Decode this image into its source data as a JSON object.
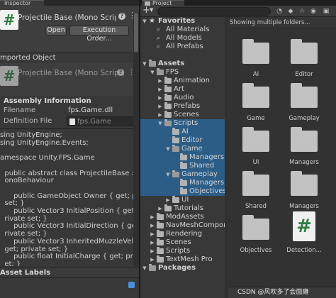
{
  "inspector": {
    "tab_label": "Inspector",
    "header": {
      "title": "Projectile Base (Mono Script)",
      "open_label": "Open",
      "exec_order_label": "Execution Order..."
    },
    "imported_object_label": "mported Object",
    "component": {
      "title": "Projectile Base (Mono Script)"
    },
    "assembly": {
      "title": "Assembly Information",
      "filename_label": "Filename",
      "filename_value": "fps.Game.dll",
      "definition_label": "Definition File",
      "definition_value": "fps.Game"
    },
    "code_lines": [
      "sing UnityEngine;",
      "sing UnityEngine.Events;",
      "",
      "amespace Unity.FPS.Game",
      "",
      "  public abstract class ProjectileBase :",
      "  onoBehaviour",
      "",
      "      public GameObject Owner { get; private",
      "  set; }",
      "      public Vector3 InitialPosition { get;",
      "  rivate set; }",
      "      public Vector3 InitialDirection { get;",
      "  rivate set; }",
      "      public Vector3 InheritedMuzzleVelocity",
      "  get; private set; }",
      "      public float InitialCharge { get; private",
      "  et; }"
    ],
    "asset_labels": "Asset Labels"
  },
  "project": {
    "tab_label": "Project",
    "grid_header": "Showing multiple folders...",
    "tree": [
      {
        "label": "Favorites",
        "depth": 0,
        "expanded": true,
        "kind": "star",
        "bold": true,
        "selected": false
      },
      {
        "label": "All Materials",
        "depth": 1,
        "kind": "search",
        "selected": false
      },
      {
        "label": "All Models",
        "depth": 1,
        "kind": "search",
        "selected": false
      },
      {
        "label": "All Prefabs",
        "depth": 1,
        "kind": "search",
        "selected": false
      },
      {
        "label": "",
        "depth": 0,
        "kind": "spacer",
        "selected": false
      },
      {
        "label": "Assets",
        "depth": 0,
        "expanded": true,
        "kind": "folder",
        "bold": true,
        "selected": false
      },
      {
        "label": "FPS",
        "depth": 1,
        "expanded": true,
        "kind": "folder",
        "selected": false
      },
      {
        "label": "Animation",
        "depth": 2,
        "expanded": false,
        "kind": "folder",
        "selected": false
      },
      {
        "label": "Art",
        "depth": 2,
        "expanded": false,
        "kind": "folder",
        "selected": false
      },
      {
        "label": "Audio",
        "depth": 2,
        "expanded": false,
        "kind": "folder",
        "selected": false
      },
      {
        "label": "Prefabs",
        "depth": 2,
        "expanded": false,
        "kind": "folder",
        "selected": false
      },
      {
        "label": "Scenes",
        "depth": 2,
        "expanded": false,
        "kind": "folder",
        "selected": false
      },
      {
        "label": "Scripts",
        "depth": 2,
        "expanded": true,
        "kind": "folder",
        "selected": true
      },
      {
        "label": "AI",
        "depth": 3,
        "kind": "folder",
        "selected": true
      },
      {
        "label": "Editor",
        "depth": 3,
        "kind": "folder",
        "selected": true
      },
      {
        "label": "Game",
        "depth": 3,
        "expanded": true,
        "kind": "folder",
        "selected": true
      },
      {
        "label": "Managers",
        "depth": 4,
        "kind": "folder",
        "selected": true
      },
      {
        "label": "Shared",
        "depth": 4,
        "kind": "folder",
        "selected": true
      },
      {
        "label": "Gameplay",
        "depth": 3,
        "expanded": true,
        "kind": "folder",
        "selected": true
      },
      {
        "label": "Managers",
        "depth": 4,
        "kind": "folder",
        "selected": true
      },
      {
        "label": "Objectives",
        "depth": 4,
        "kind": "folder",
        "selected": true
      },
      {
        "label": "UI",
        "depth": 3,
        "expanded": false,
        "kind": "folder",
        "selected": false
      },
      {
        "label": "Tutorials",
        "depth": 2,
        "expanded": false,
        "kind": "folder",
        "selected": false
      },
      {
        "label": "ModAssets",
        "depth": 1,
        "expanded": false,
        "kind": "folder",
        "selected": false
      },
      {
        "label": "NavMeshComponen",
        "depth": 1,
        "expanded": false,
        "kind": "folder",
        "selected": false
      },
      {
        "label": "Rendering",
        "depth": 1,
        "expanded": false,
        "kind": "folder",
        "selected": false
      },
      {
        "label": "Scenes",
        "depth": 1,
        "expanded": false,
        "kind": "folder",
        "selected": false
      },
      {
        "label": "Scripts",
        "depth": 1,
        "expanded": false,
        "kind": "folder",
        "selected": false
      },
      {
        "label": "TextMesh Pro",
        "depth": 1,
        "expanded": false,
        "kind": "folder",
        "selected": false
      },
      {
        "label": "Packages",
        "depth": 0,
        "expanded": true,
        "kind": "folder",
        "bold": true,
        "selected": false
      }
    ],
    "grid": [
      {
        "label": "AI",
        "kind": "folder"
      },
      {
        "label": "Editor",
        "kind": "folder"
      },
      {
        "label": "Game",
        "kind": "folder"
      },
      {
        "label": "Gameplay",
        "kind": "folder"
      },
      {
        "label": "UI",
        "kind": "folder"
      },
      {
        "label": "Managers",
        "kind": "folder"
      },
      {
        "label": "Shared",
        "kind": "folder"
      },
      {
        "label": "Managers",
        "kind": "folder"
      },
      {
        "label": "Objectives",
        "kind": "folder"
      },
      {
        "label": "Detection...",
        "kind": "script"
      }
    ],
    "watermark": "CSDN @风吹多了会面瘫"
  },
  "icons": {
    "script": "#",
    "help": "?",
    "more": "⋮",
    "star": "★",
    "search": "⌕",
    "tag": "tag-icon"
  },
  "colors": {
    "selection": "#2c5d87",
    "script_green": "#2e7d43"
  }
}
